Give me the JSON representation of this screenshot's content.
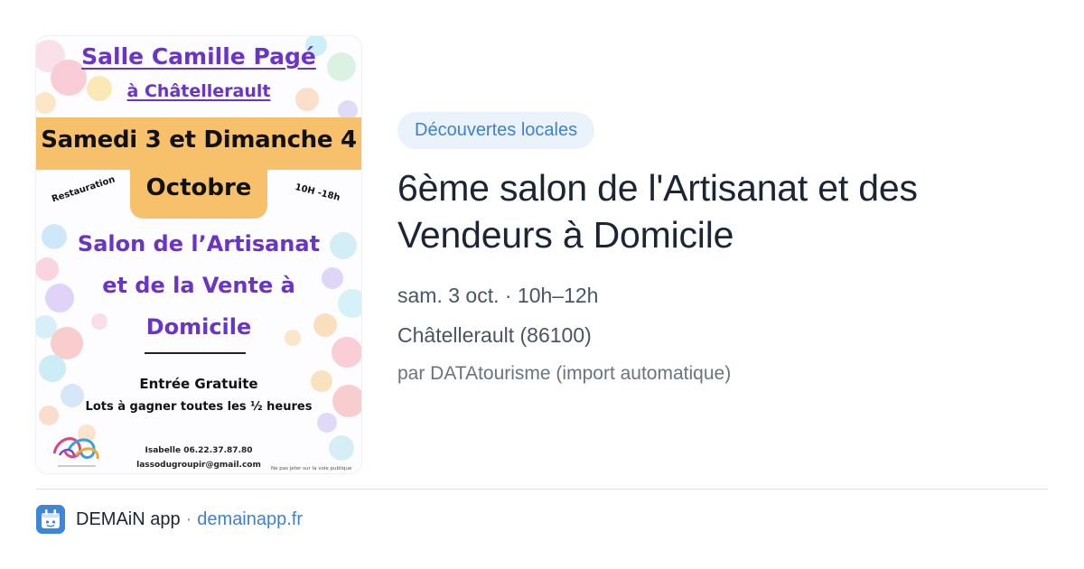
{
  "poster": {
    "venue": "Salle Camille Pagé",
    "city": "à Châtellerault",
    "dates_line1": "Samedi 3 et Dimanche 4",
    "dates_line2": "Octobre",
    "restauration": "Restauration",
    "hours": "10H -18h",
    "salon_line1": "Salon de l’Artisanat",
    "salon_line2": "et de la Vente à",
    "salon_line3": "Domicile",
    "entree": "Entrée Gratuite",
    "lots": "Lots à gagner  toutes les ½ heures",
    "phone": "Isabelle 06.22.37.87.80",
    "email": "lassodugroupir@gmail.com",
    "small_note": "Ne pas jeter sur la voie publique"
  },
  "event": {
    "category": "Découvertes locales",
    "title": "6ème salon de l'Artisanat et des Vendeurs à Domicile",
    "date_time": "sam. 3 oct. · 10h–12h",
    "location": "Châtellerault (86100)",
    "source": "par DATAtourisme (import automatique)"
  },
  "footer": {
    "app_name": "DEMAiN app",
    "separator": "·",
    "domain": "demainapp.fr"
  },
  "colors": {
    "accent_blue": "#3f80cf",
    "tag_background": "#eaf2fc",
    "title_text": "#1c2536",
    "poster_purple": "#6a34c8",
    "poster_band": "#f6c16a"
  },
  "icons": {
    "app": "demain-app-icon",
    "poster_logo": "colorful-swirl-logo"
  }
}
